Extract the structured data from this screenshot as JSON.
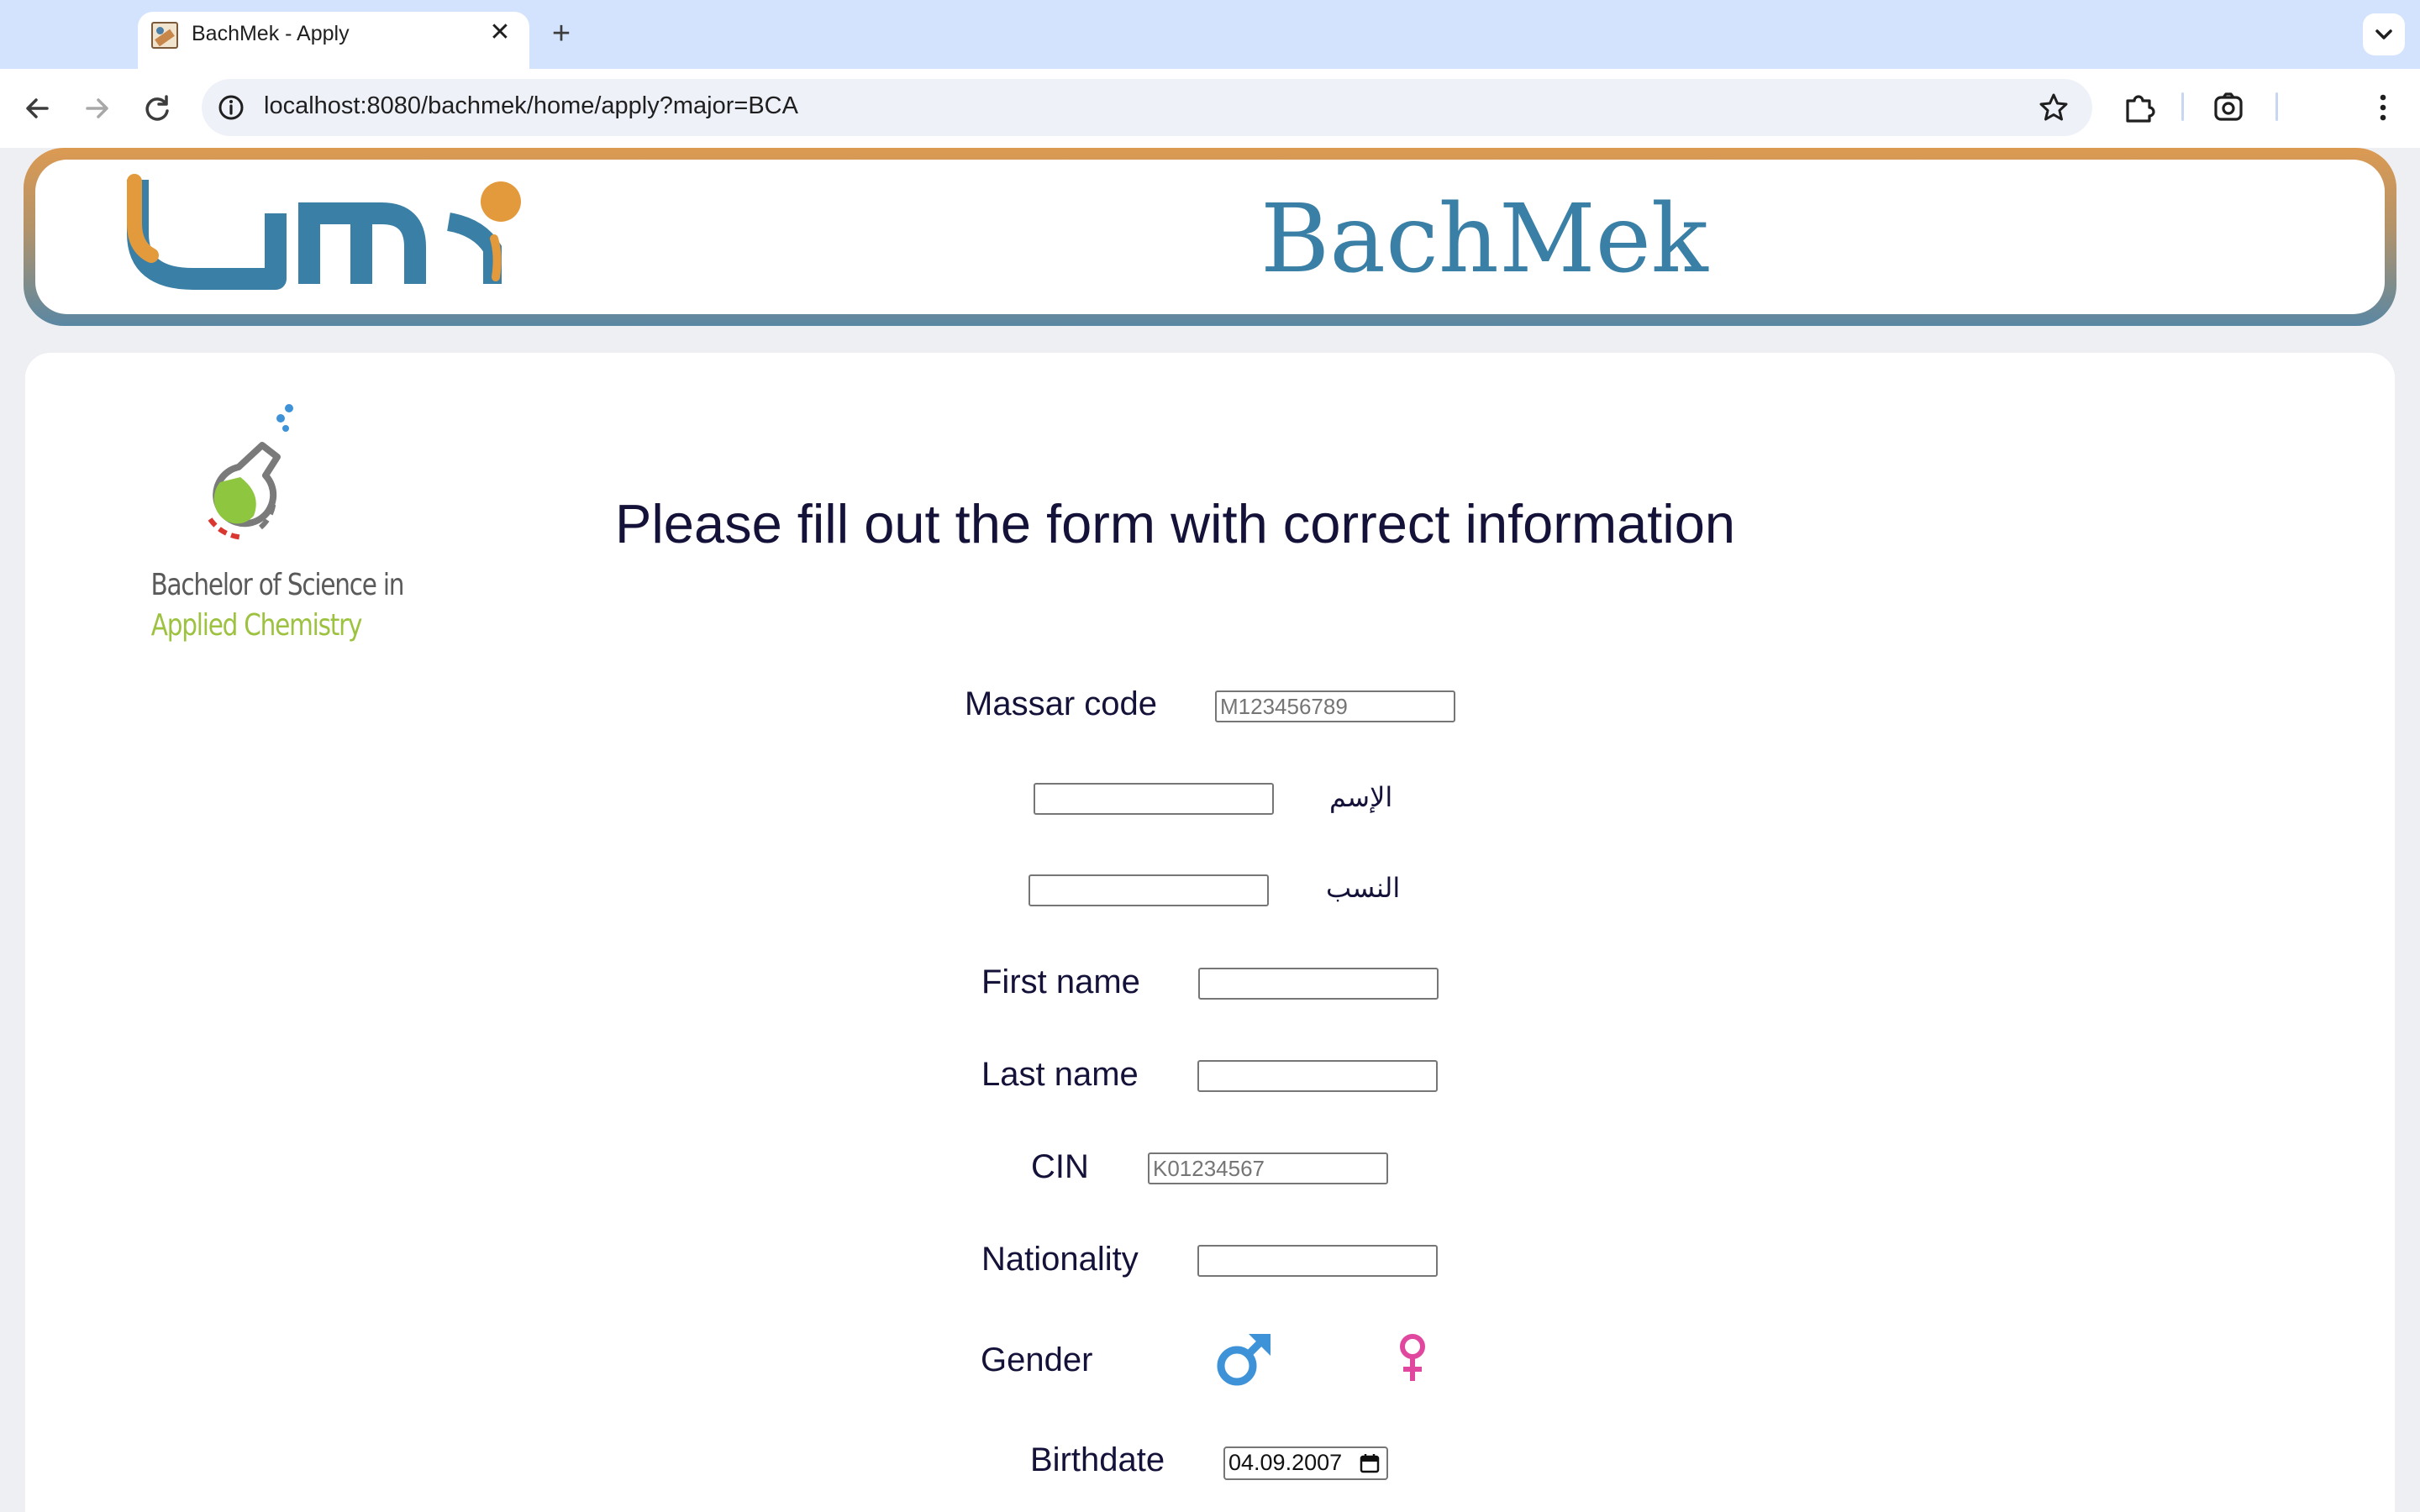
{
  "browser": {
    "tab_title": "BachMek - Apply",
    "tab_close_glyph": "✕",
    "new_tab_glyph": "+",
    "url": "localhost:8080/bachmek/home/apply?major=BCA",
    "icons": [
      "back-arrow-icon",
      "forward-arrow-icon",
      "reload-icon",
      "site-info-icon",
      "bookmark-star-icon",
      "extensions-icon",
      "google-lens-icon",
      "kebab-menu-icon",
      "tab-search-chevron-icon"
    ]
  },
  "banner": {
    "title": "BachMek",
    "logo_colors": {
      "orange": "#e39a3c",
      "blue": "#3a7fa5"
    }
  },
  "program_logo": {
    "line1": "Bachelor of Science in",
    "line2": "Applied Chemistry"
  },
  "form": {
    "heading": "Please fill out the form with correct information",
    "massar": {
      "label": "Massar code",
      "placeholder": "M123456789"
    },
    "arabic_first": {
      "label": "الإسم",
      "value": ""
    },
    "arabic_last": {
      "label": "النسب",
      "value": ""
    },
    "first_name": {
      "label": "First name",
      "value": ""
    },
    "last_name": {
      "label": "Last name",
      "value": ""
    },
    "cin": {
      "label": "CIN",
      "placeholder": "K01234567"
    },
    "nationality": {
      "label": "Nationality",
      "value": ""
    },
    "gender": {
      "label": "Gender",
      "options": [
        "male-symbol-icon",
        "female-symbol-icon"
      ],
      "male_color": "#3d92d8",
      "female_color": "#e0489f"
    },
    "birthdate": {
      "label": "Birthdate",
      "value": "04.09.2007"
    }
  }
}
